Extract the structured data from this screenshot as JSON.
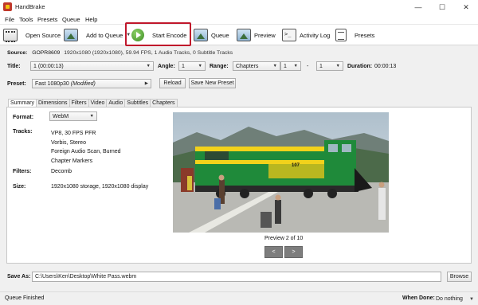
{
  "window": {
    "title": "HandBrake",
    "minimize": "—",
    "maximize": "☐",
    "close": "✕"
  },
  "menu": [
    "File",
    "Tools",
    "Presets",
    "Queue",
    "Help"
  ],
  "toolbar": {
    "open_source": "Open Source",
    "add_to_queue": "Add to Queue",
    "start_encode": "Start Encode",
    "queue": "Queue",
    "preview": "Preview",
    "activity_log": "Activity Log",
    "presets": "Presets"
  },
  "source": {
    "label": "Source:",
    "value": "GOPR8609",
    "details": "1920x1080 (1920x1080), 59.94 FPS, 1 Audio Tracks, 0 Subtitle Tracks"
  },
  "title_row": {
    "title_label": "Title:",
    "title_value": "1  (00:00:13)",
    "angle_label": "Angle:",
    "angle_value": "1",
    "range_label": "Range:",
    "range_value": "Chapters",
    "range_start": "1",
    "range_sep": "-",
    "range_end": "1",
    "duration_label": "Duration:",
    "duration_value": "00:00:13"
  },
  "preset": {
    "label": "Preset:",
    "value": "Fast 1080p30",
    "modified": "(Modified)",
    "reload": "Reload",
    "save_new": "Save New Preset"
  },
  "tabs": [
    "Summary",
    "Dimensions",
    "Filters",
    "Video",
    "Audio",
    "Subtitles",
    "Chapters"
  ],
  "summary": {
    "format_label": "Format:",
    "format_value": "WebM",
    "tracks_label": "Tracks:",
    "tracks": [
      "VP8, 30 FPS PFR",
      "Vorbis, Stereo",
      "Foreign Audio Scan, Burned",
      "Chapter Markers"
    ],
    "filters_label": "Filters:",
    "filters_value": "Decomb",
    "size_label": "Size:",
    "size_value": "1920x1080 storage, 1920x1080 display"
  },
  "preview": {
    "caption": "Preview 2 of 10",
    "prev": "<",
    "next": ">",
    "train_number": "107"
  },
  "save_as": {
    "label": "Save As:",
    "value": "C:\\Users\\Ken\\Desktop\\White Pass.webm",
    "browse": "Browse"
  },
  "status": {
    "text": "Queue Finished",
    "when_done_label": "When Done:",
    "when_done_value": "Do nothing"
  }
}
